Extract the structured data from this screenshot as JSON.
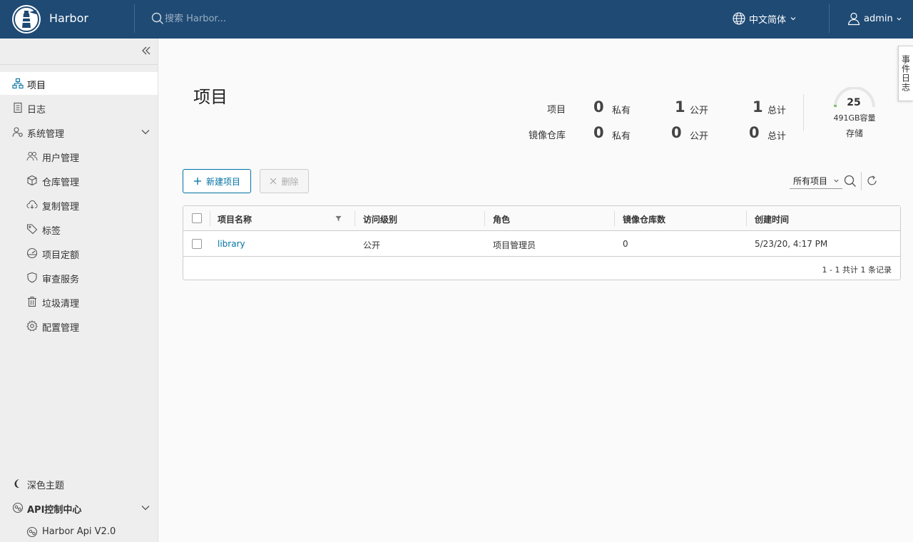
{
  "header": {
    "brand": "Harbor",
    "search_placeholder": "搜索 Harbor...",
    "language": "中文简体",
    "user": "admin"
  },
  "sidebar": {
    "items": [
      {
        "label": "项目",
        "icon": "projects-icon",
        "active": true
      },
      {
        "label": "日志",
        "icon": "logs-icon"
      },
      {
        "label": "系统管理",
        "icon": "admin-icon",
        "expandable": true
      },
      {
        "label": "用户管理",
        "icon": "users-icon",
        "sub": true
      },
      {
        "label": "仓库管理",
        "icon": "registry-icon",
        "sub": true
      },
      {
        "label": "复制管理",
        "icon": "replication-icon",
        "sub": true
      },
      {
        "label": "标签",
        "icon": "tag-icon",
        "sub": true
      },
      {
        "label": "项目定额",
        "icon": "quota-icon",
        "sub": true
      },
      {
        "label": "审查服务",
        "icon": "shield-icon",
        "sub": true
      },
      {
        "label": "垃圾清理",
        "icon": "trash-icon",
        "sub": true
      },
      {
        "label": "配置管理",
        "icon": "gear-icon",
        "sub": true
      }
    ],
    "bottom": [
      {
        "label": "深色主题",
        "icon": "moon-icon"
      },
      {
        "label": "API控制中心",
        "icon": "api-icon",
        "expandable": true
      },
      {
        "label": "Harbor Api V2.0",
        "icon": "api-icon",
        "sub": true
      }
    ]
  },
  "event_tab": "事件日志",
  "main": {
    "title": "项目",
    "stats": {
      "row_labels": [
        "项目",
        "镜像仓库"
      ],
      "projects": {
        "private": "0",
        "public": "1",
        "total": "1"
      },
      "repos": {
        "private": "0",
        "public": "0",
        "total": "0"
      },
      "private_label": "私有",
      "public_label": "公开",
      "total_label": "总计"
    },
    "storage": {
      "value": "25",
      "capacity": "491GB容量",
      "label": "存储"
    },
    "buttons": {
      "new_project": "新建项目",
      "delete": "删除"
    },
    "filter": {
      "selected": "所有项目"
    },
    "table": {
      "columns": [
        "项目名称",
        "访问级别",
        "角色",
        "镜像仓库数",
        "创建时间"
      ],
      "rows": [
        {
          "name": "library",
          "access": "公开",
          "role": "项目管理员",
          "repo_count": "0",
          "created": "5/23/20, 4:17 PM"
        }
      ],
      "footer": "1 - 1 共计 1 条记录"
    }
  },
  "colors": {
    "header": "#1e4a74",
    "link": "#0072a3",
    "sidebar": "#eeeeee",
    "gauge_ok": "#7cc36a"
  }
}
